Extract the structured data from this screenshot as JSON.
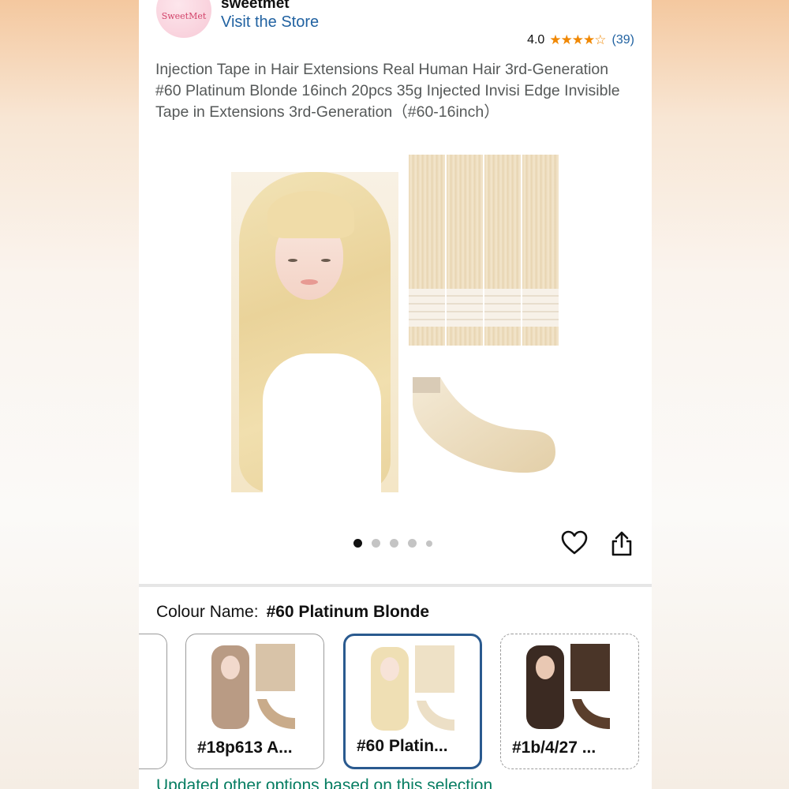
{
  "store": {
    "logo_text": "SweetMet",
    "name": "sweetmet",
    "link_label": "Visit the Store"
  },
  "rating": {
    "score": "4.0",
    "stars_filled": 4,
    "stars_total": 5,
    "count": "(39)"
  },
  "product": {
    "title": "Injection Tape in Hair Extensions Real Human Hair 3rd-Generation #60 Platinum Blonde 16inch 20pcs 35g Injected Invisi Edge Invisible Tape in Extensions 3rd-Generation（#60-16inch）"
  },
  "gallery": {
    "image_count": 5,
    "active_index": 0
  },
  "variation": {
    "label": "Colour Name:",
    "selected_value": "#60 Platinum Blonde",
    "options": [
      {
        "label": "",
        "state": "partial"
      },
      {
        "label": "#18p613 A...",
        "state": "normal"
      },
      {
        "label": "#60 Platin...",
        "state": "selected"
      },
      {
        "label": "#1b/4/27 ...",
        "state": "dashed"
      }
    ]
  },
  "notice": "Updated other options based on this selection",
  "colors": {
    "link": "#2162a1",
    "star": "#f08804",
    "selected_border": "#2a5a8f",
    "notice": "#067d62"
  }
}
